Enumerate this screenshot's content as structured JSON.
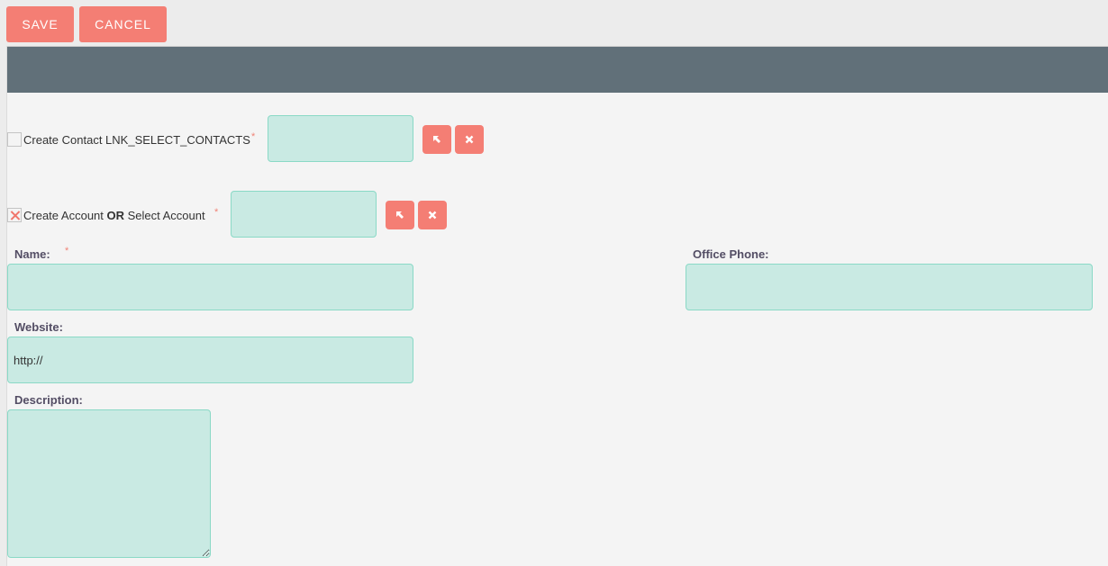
{
  "toolbar": {
    "save_label": "SAVE",
    "cancel_label": "CANCEL"
  },
  "header": {
    "title": ""
  },
  "contact_row": {
    "checkbox_checked": false,
    "label": "Create Contact LNK_SELECT_CONTACTS",
    "required_marker": "*",
    "input_value": "",
    "select_icon": "arrow-select-icon",
    "clear_icon": "clear-x-icon"
  },
  "account_row": {
    "checkbox_checked": true,
    "label_part1": "Create Account ",
    "label_or": "OR",
    "label_part2": " Select Account",
    "required_marker": "*",
    "input_value": "",
    "select_icon": "arrow-select-icon",
    "clear_icon": "clear-x-icon"
  },
  "fields": {
    "name": {
      "label": "Name:",
      "required_marker": "*",
      "value": ""
    },
    "office_phone": {
      "label": "Office Phone:",
      "value": ""
    },
    "website": {
      "label": "Website:",
      "value": "http://"
    },
    "description": {
      "label": "Description:",
      "value": ""
    }
  },
  "colors": {
    "button": "#f47e74",
    "header": "#617079",
    "input_bg": "#c9eae3",
    "input_border": "#8ad9c6"
  }
}
